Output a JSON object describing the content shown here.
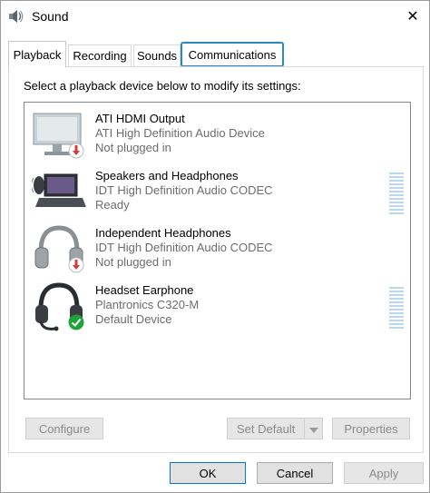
{
  "window": {
    "title": "Sound",
    "title_icon": "speaker-icon",
    "close_glyph": "✕"
  },
  "tabs": [
    {
      "label": "Playback",
      "active": true
    },
    {
      "label": "Recording",
      "active": false
    },
    {
      "label": "Sounds",
      "active": false
    },
    {
      "label": "Communications",
      "active": false,
      "highlighted": true
    }
  ],
  "instruction": "Select a playback device below to modify its settings:",
  "devices": [
    {
      "name": "ATI HDMI Output",
      "driver": "ATI High Definition Audio Device",
      "status": "Not plugged in",
      "icon": "monitor-icon",
      "badge": "unplugged-badge-icon",
      "level_meter": false
    },
    {
      "name": "Speakers and Headphones",
      "driver": "IDT High Definition Audio CODEC",
      "status": "Ready",
      "icon": "laptop-speaker-icon",
      "level_meter": true
    },
    {
      "name": "Independent Headphones",
      "driver": "IDT High Definition Audio CODEC",
      "status": "Not plugged in",
      "icon": "headphones-icon",
      "badge": "unplugged-badge-icon",
      "level_meter": false
    },
    {
      "name": "Headset Earphone",
      "driver": "Plantronics C320-M",
      "status": "Default Device",
      "icon": "headset-icon",
      "badge": "default-check-badge-icon",
      "level_meter": true
    }
  ],
  "panel_buttons": {
    "configure": "Configure",
    "set_default": "Set Default",
    "properties": "Properties"
  },
  "dialog_buttons": {
    "ok": "OK",
    "cancel": "Cancel",
    "apply": "Apply"
  },
  "colors": {
    "accent": "#0078d7",
    "highlight_border": "#2e86c1",
    "meter": "#b8d8ec",
    "badge_red": "#d83b3b",
    "badge_green": "#22a33a"
  }
}
